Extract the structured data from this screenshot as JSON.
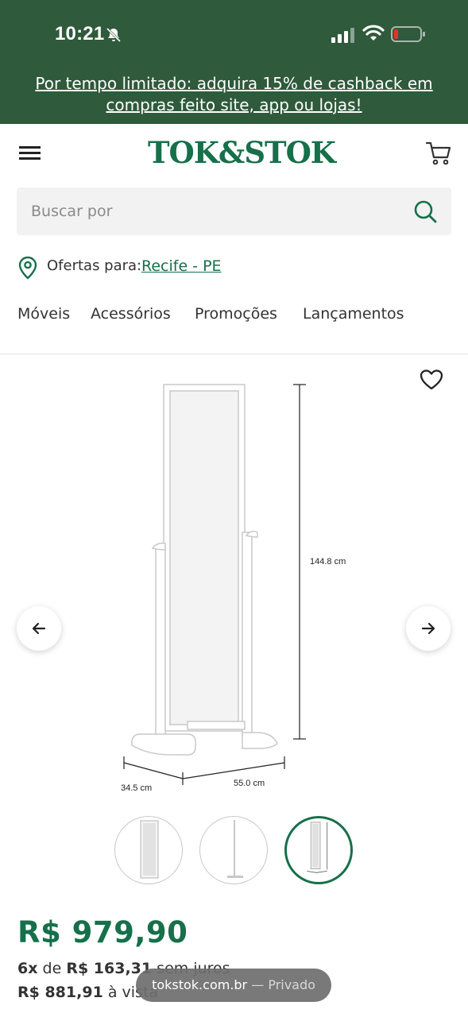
{
  "status_bar": {
    "time": "10:21"
  },
  "promo": {
    "text": "Por tempo limitado: adquira 15% de cashback em compras feito site, app ou lojas!"
  },
  "header": {
    "logo": "TOK&STOK"
  },
  "search": {
    "placeholder": "Buscar por",
    "value": ""
  },
  "location": {
    "label": "Ofertas para:",
    "city": "Recife - PE"
  },
  "nav": {
    "items": [
      "Móveis",
      "Acessórios",
      "Promoções",
      "Lançamentos"
    ]
  },
  "product": {
    "dimensions": {
      "height": "144.8 cm",
      "depth": "34.5 cm",
      "width": "55.0 cm"
    },
    "price": "R$ 979,90",
    "installment": {
      "count": "6x",
      "connector": "de",
      "value": "R$ 163,31",
      "suffix": "sem juros"
    },
    "cash": {
      "value": "R$ 881,91",
      "suffix": "à vista"
    },
    "thumbnails_count": 3,
    "active_thumbnail": 3
  },
  "browser": {
    "domain": "tokstok.com.br",
    "mode": "— Privado"
  },
  "colors": {
    "brand_green": "#16704a",
    "header_green": "#2f5a3b"
  }
}
